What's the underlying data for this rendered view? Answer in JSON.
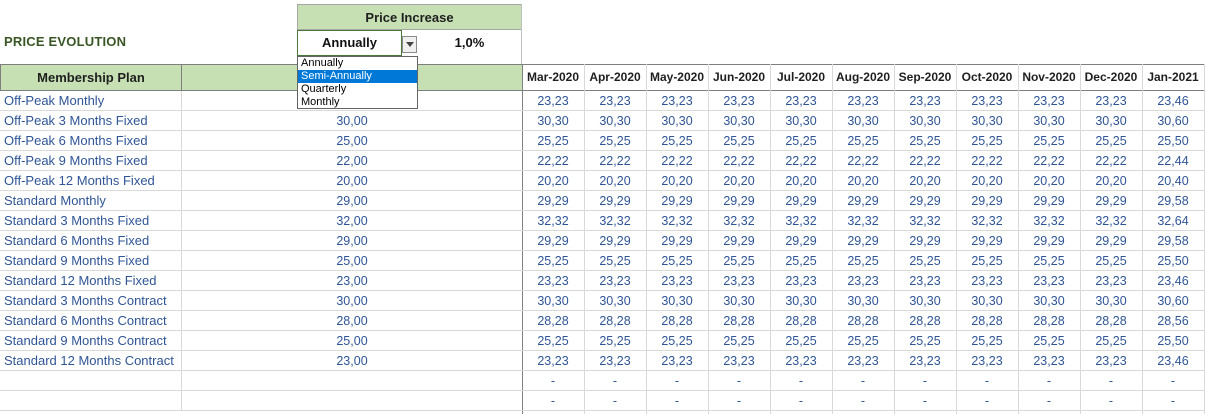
{
  "header": {
    "title": "PRICE EVOLUTION",
    "price_increase_label": "Price Increase",
    "frequency_value": "Annually",
    "rate_value": "1,0%"
  },
  "dropdown": {
    "options": [
      "Annually",
      "Semi-Annually",
      "Quarterly",
      "Monthly"
    ],
    "highlighted": "Semi-Annually"
  },
  "table": {
    "plan_header": "Membership Plan",
    "months": [
      "Mar-2020",
      "Apr-2020",
      "May-2020",
      "Jun-2020",
      "Jul-2020",
      "Aug-2020",
      "Sep-2020",
      "Oct-2020",
      "Nov-2020",
      "Dec-2020",
      "Jan-2021"
    ],
    "rows": [
      {
        "plan": "Off-Peak Monthly",
        "price": "",
        "values": [
          "23,23",
          "23,23",
          "23,23",
          "23,23",
          "23,23",
          "23,23",
          "23,23",
          "23,23",
          "23,23",
          "23,23",
          "23,46"
        ]
      },
      {
        "plan": "Off-Peak 3 Months Fixed",
        "price": "30,00",
        "values": [
          "30,30",
          "30,30",
          "30,30",
          "30,30",
          "30,30",
          "30,30",
          "30,30",
          "30,30",
          "30,30",
          "30,30",
          "30,60"
        ]
      },
      {
        "plan": "Off-Peak 6 Months Fixed",
        "price": "25,00",
        "values": [
          "25,25",
          "25,25",
          "25,25",
          "25,25",
          "25,25",
          "25,25",
          "25,25",
          "25,25",
          "25,25",
          "25,25",
          "25,50"
        ]
      },
      {
        "plan": "Off-Peak 9 Months Fixed",
        "price": "22,00",
        "values": [
          "22,22",
          "22,22",
          "22,22",
          "22,22",
          "22,22",
          "22,22",
          "22,22",
          "22,22",
          "22,22",
          "22,22",
          "22,44"
        ]
      },
      {
        "plan": "Off-Peak 12 Months Fixed",
        "price": "20,00",
        "values": [
          "20,20",
          "20,20",
          "20,20",
          "20,20",
          "20,20",
          "20,20",
          "20,20",
          "20,20",
          "20,20",
          "20,20",
          "20,40"
        ]
      },
      {
        "plan": "Standard Monthly",
        "price": "29,00",
        "values": [
          "29,29",
          "29,29",
          "29,29",
          "29,29",
          "29,29",
          "29,29",
          "29,29",
          "29,29",
          "29,29",
          "29,29",
          "29,58"
        ]
      },
      {
        "plan": "Standard 3 Months Fixed",
        "price": "32,00",
        "values": [
          "32,32",
          "32,32",
          "32,32",
          "32,32",
          "32,32",
          "32,32",
          "32,32",
          "32,32",
          "32,32",
          "32,32",
          "32,64"
        ]
      },
      {
        "plan": "Standard 6 Months Fixed",
        "price": "29,00",
        "values": [
          "29,29",
          "29,29",
          "29,29",
          "29,29",
          "29,29",
          "29,29",
          "29,29",
          "29,29",
          "29,29",
          "29,29",
          "29,58"
        ]
      },
      {
        "plan": "Standard 9 Months Fixed",
        "price": "25,00",
        "values": [
          "25,25",
          "25,25",
          "25,25",
          "25,25",
          "25,25",
          "25,25",
          "25,25",
          "25,25",
          "25,25",
          "25,25",
          "25,50"
        ]
      },
      {
        "plan": "Standard 12 Months Fixed",
        "price": "23,00",
        "values": [
          "23,23",
          "23,23",
          "23,23",
          "23,23",
          "23,23",
          "23,23",
          "23,23",
          "23,23",
          "23,23",
          "23,23",
          "23,46"
        ]
      },
      {
        "plan": "Standard 3 Months Contract",
        "price": "30,00",
        "values": [
          "30,30",
          "30,30",
          "30,30",
          "30,30",
          "30,30",
          "30,30",
          "30,30",
          "30,30",
          "30,30",
          "30,30",
          "30,60"
        ]
      },
      {
        "plan": "Standard 6 Months Contract",
        "price": "28,00",
        "values": [
          "28,28",
          "28,28",
          "28,28",
          "28,28",
          "28,28",
          "28,28",
          "28,28",
          "28,28",
          "28,28",
          "28,28",
          "28,56"
        ]
      },
      {
        "plan": "Standard 9 Months Contract",
        "price": "25,00",
        "values": [
          "25,25",
          "25,25",
          "25,25",
          "25,25",
          "25,25",
          "25,25",
          "25,25",
          "25,25",
          "25,25",
          "25,25",
          "25,50"
        ]
      },
      {
        "plan": "Standard 12 Months Contract",
        "price": "23,00",
        "values": [
          "23,23",
          "23,23",
          "23,23",
          "23,23",
          "23,23",
          "23,23",
          "23,23",
          "23,23",
          "23,23",
          "23,23",
          "23,46"
        ]
      },
      {
        "plan": "",
        "price": "",
        "values": [
          "-",
          "-",
          "-",
          "-",
          "-",
          "-",
          "-",
          "-",
          "-",
          "-",
          "-"
        ]
      },
      {
        "plan": "",
        "price": "",
        "values": [
          "-",
          "-",
          "-",
          "-",
          "-",
          "-",
          "-",
          "-",
          "-",
          "-",
          "-"
        ]
      }
    ]
  },
  "colors": {
    "header_fill": "#c6e0b4",
    "title_text": "#375623",
    "cell_text": "#2f5597",
    "selection": "#0078d7"
  }
}
